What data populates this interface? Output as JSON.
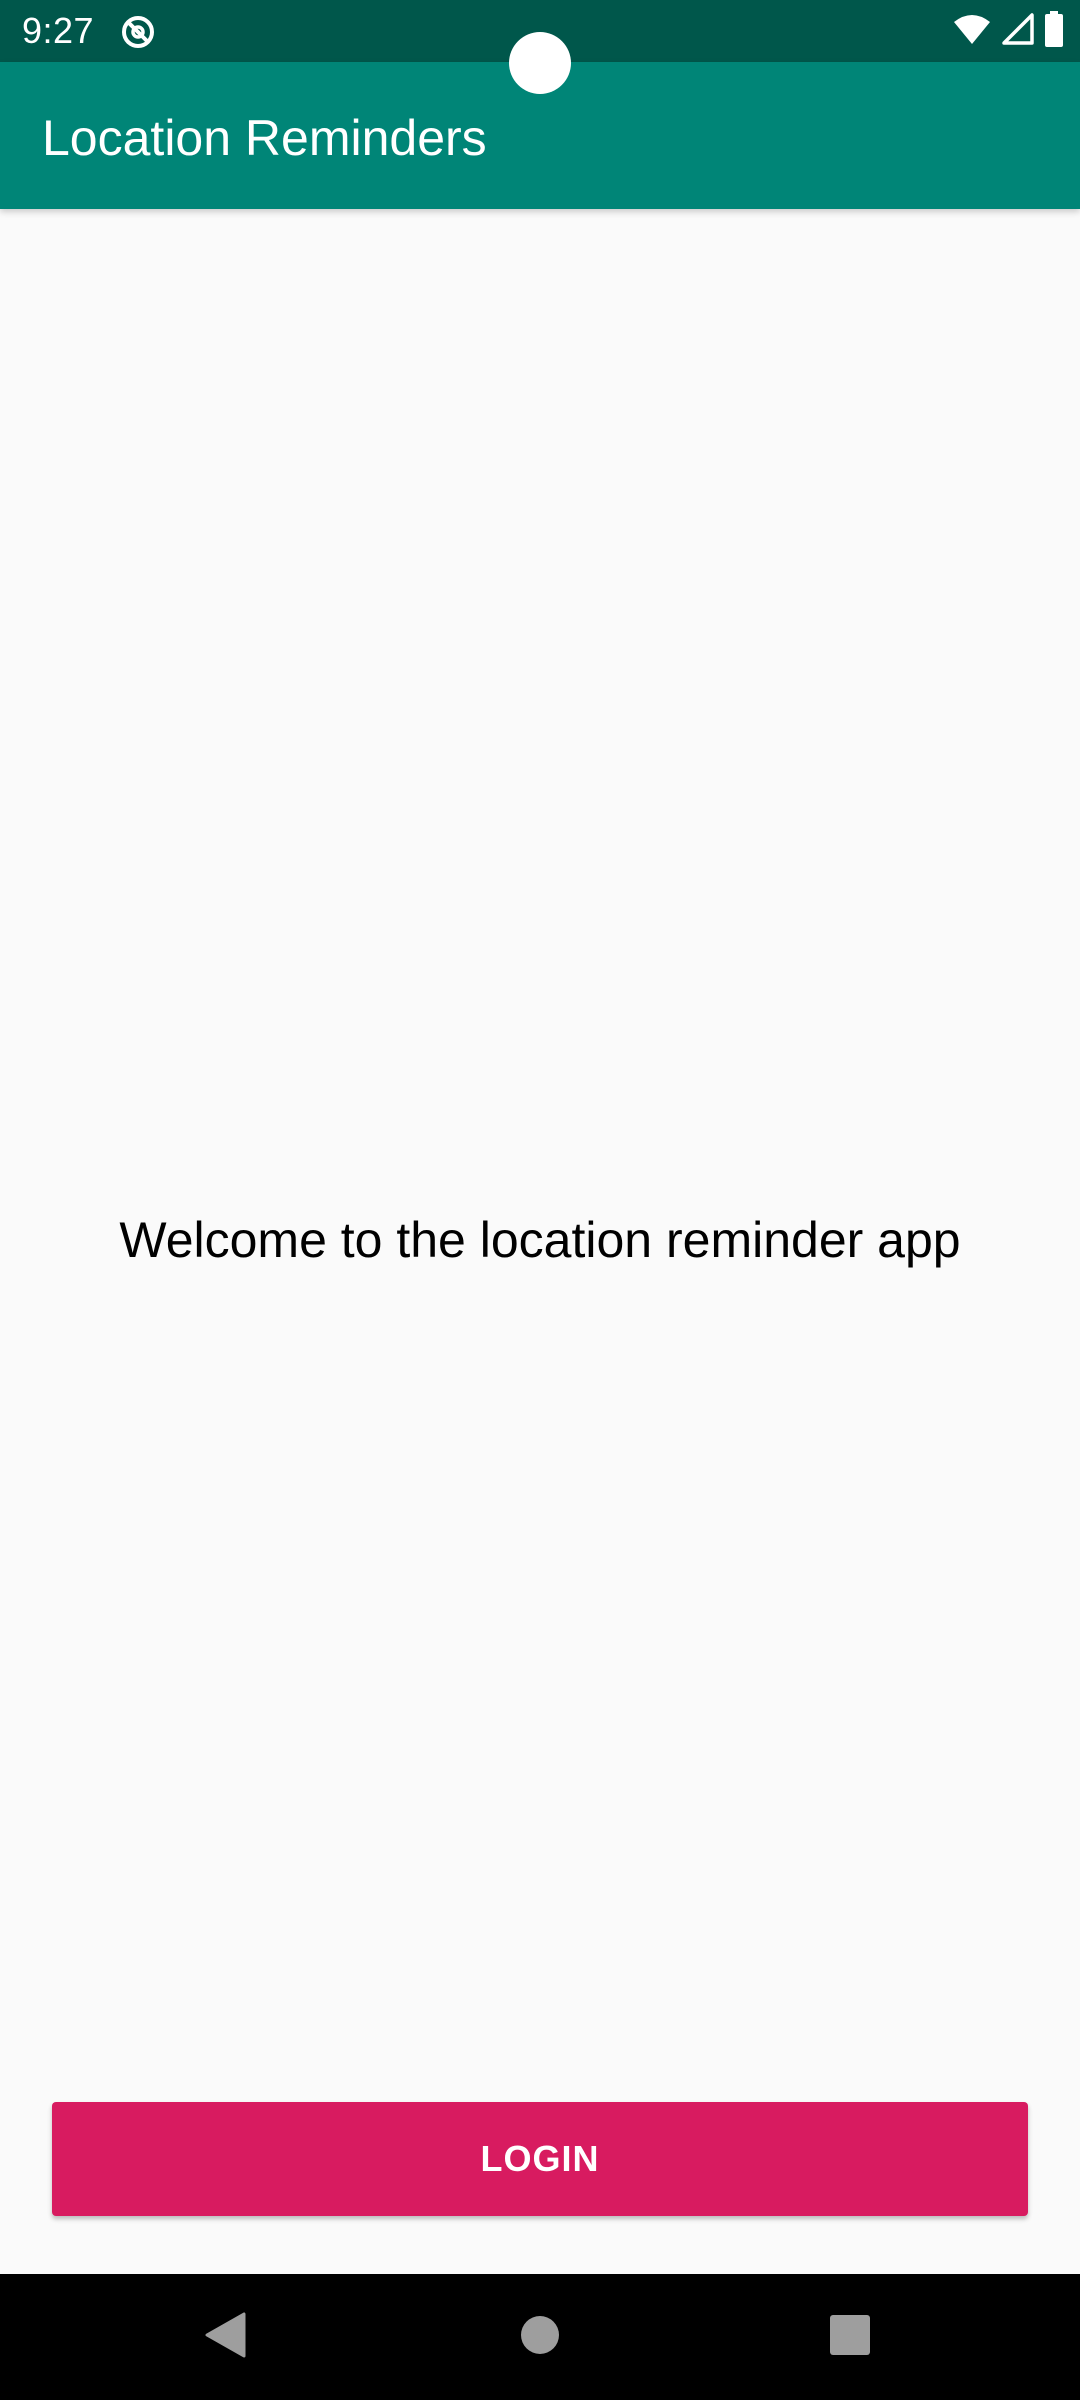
{
  "status_bar": {
    "time": "9:27",
    "icons": [
      "do-not-disturb-icon",
      "wifi-icon",
      "cellular-signal-icon",
      "battery-icon"
    ],
    "background_color": "#00574b"
  },
  "app_bar": {
    "title": "Location Reminders",
    "background_color": "#008577"
  },
  "main": {
    "welcome_text": "Welcome to the location reminder app"
  },
  "login_button": {
    "label": "LOGIN",
    "background_color": "#d81b60"
  },
  "nav_bar": {
    "buttons": [
      "back-icon",
      "home-icon",
      "recents-icon"
    ]
  }
}
